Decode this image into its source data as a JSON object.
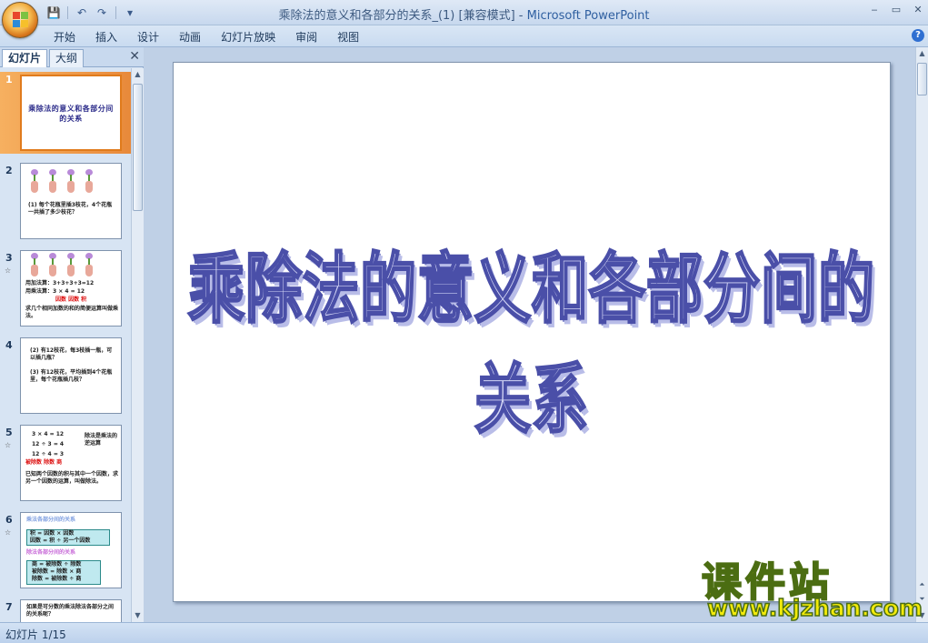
{
  "window": {
    "title_doc": "乘除法的意义和各部分的关系_(1) [兼容模式]",
    "title_sep": " - ",
    "title_app": "Microsoft PowerPoint",
    "minimize": "‒",
    "restore": "▭",
    "close": "✕"
  },
  "qat": {
    "save": "💾",
    "undo": "↶",
    "redo": "↷",
    "customize": "▾"
  },
  "ribbon": {
    "tabs": [
      "开始",
      "插入",
      "设计",
      "动画",
      "幻灯片放映",
      "审阅",
      "视图"
    ],
    "help": "?"
  },
  "pane": {
    "tab_slides": "幻灯片",
    "tab_outline": "大纲",
    "close": "✕"
  },
  "thumbnails": [
    {
      "num": "1",
      "title": "乘除法的意义和各部分间的关系"
    },
    {
      "num": "2",
      "text": "(1) 每个花瓶里插3枝花，4个花瓶一共插了多少枝花？"
    },
    {
      "num": "3",
      "anim": "☆",
      "l1": "用加法算：3+3+3+3=12",
      "l2": "用乘法算：3 × 4 = 12",
      "l3": "因数 因数 积",
      "l4": "求几个相同加数的和的简便运算叫做乘法。"
    },
    {
      "num": "4",
      "l1": "(2) 有12枝花，每3枝插一瓶，可以插几瓶？",
      "l2": "(3) 有12枝花，平均插到4个花瓶里，每个花瓶插几枝？"
    },
    {
      "num": "5",
      "anim": "☆",
      "l1": "3 × 4 = 12",
      "l2": "12 ÷ 3 = 4",
      "l3": "12 ÷ 4 = 3",
      "l4": "被除数 除数 商",
      "side": "除法是乘法的逆运算",
      "l5": "已知两个因数的积与其中一个因数，求另一个因数的运算，叫做除法。"
    },
    {
      "num": "6",
      "anim": "☆",
      "h1": "乘法各部分间的关系",
      "b1": "积 = 因数 × 因数",
      "b2": "因数 = 积 ÷ 另一个因数",
      "h2": "除法各部分间的关系",
      "c1": "商 = 被除数 ÷ 除数",
      "c2": "被除数 = 除数 × 商",
      "c3": "除数 = 被除数 ÷ 商"
    },
    {
      "num": "7",
      "text": "如果是可分数的乘法除法各部分之间的关系呢？"
    }
  ],
  "slide": {
    "title": "乘除法的意义和各部分间的关系"
  },
  "status": {
    "text": "幻灯片 1/15"
  },
  "watermark": {
    "cn": "课件站",
    "url": "www.kjzhan.com"
  }
}
